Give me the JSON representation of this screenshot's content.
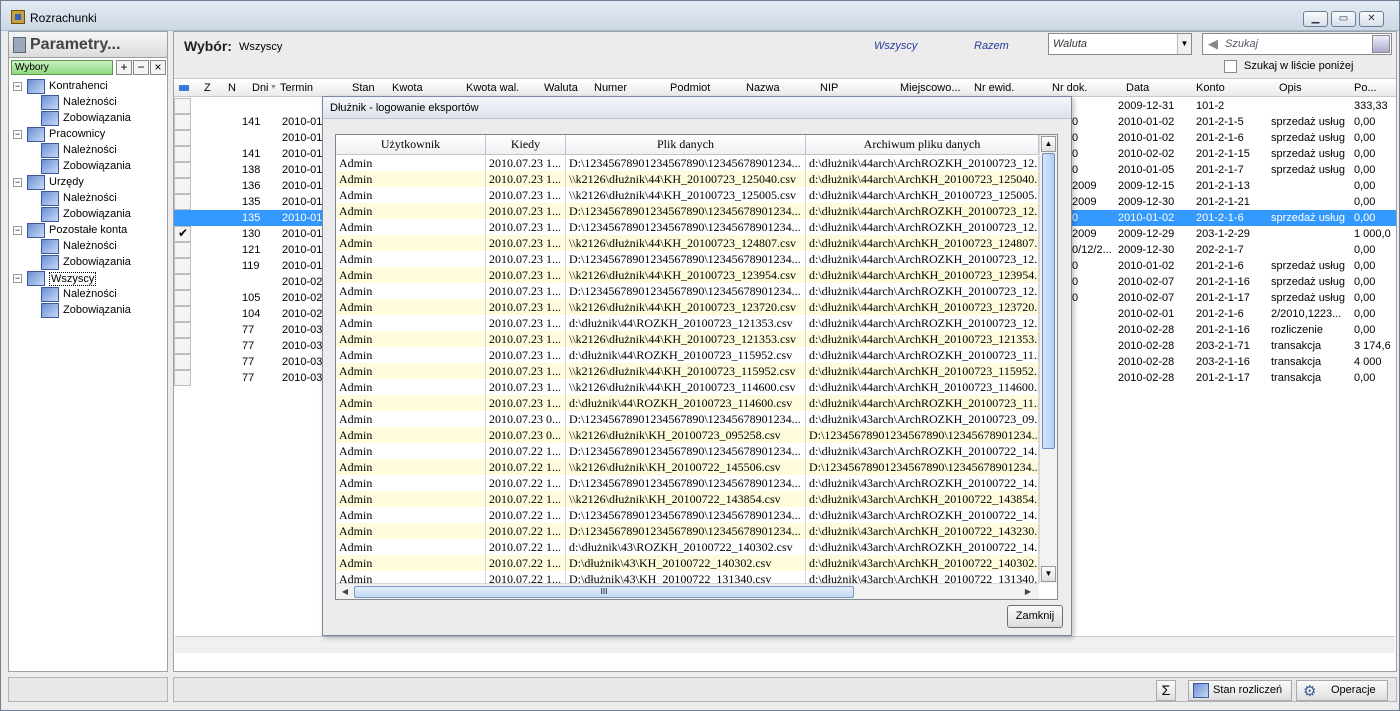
{
  "window": {
    "title": "Rozrachunki"
  },
  "left_panel": {
    "title": "Parametry...",
    "wybory_label": "Wybory",
    "tree": [
      {
        "label": "Kontrahenci",
        "children": [
          "Należności",
          "Zobowiązania"
        ]
      },
      {
        "label": "Pracownicy",
        "children": [
          "Należności",
          "Zobowiązania"
        ]
      },
      {
        "label": "Urzędy",
        "children": [
          "Należności",
          "Zobowiązania"
        ]
      },
      {
        "label": "Pozostałe konta",
        "children": [
          "Należności",
          "Zobowiązania"
        ]
      },
      {
        "label": "Wszyscy",
        "children": [
          "Należności",
          "Zobowiązania"
        ]
      }
    ]
  },
  "top": {
    "wybor_label": "Wybór:",
    "wybor_value": "Wszyscy",
    "filter_wszyscy": "Wszyscy",
    "filter_razem": "Razem",
    "currency_combo": "Waluta",
    "search_placeholder": "Szukaj",
    "search_in_list_label": "Szukaj w liście poniżej"
  },
  "grid": {
    "headers": [
      "Z",
      "N",
      "Dni",
      "Termin",
      "Stan",
      "Kwota",
      "Kwota wal.",
      "Waluta",
      "Numer",
      "Podmiot",
      "Nazwa",
      "NIP",
      "Miejscowo...",
      "Nr ewid.",
      "Nr dok.",
      "Data",
      "Konto",
      "Opis",
      "Po..."
    ],
    "rows": [
      {
        "dni": "",
        "termin": "",
        "nrdok": "",
        "data": "2009-12-31",
        "konto": "101-2",
        "opis": "",
        "po": "333,33",
        "checked": false,
        "selected": false
      },
      {
        "dni": "141",
        "termin": "2010-01",
        "nrdok": "0",
        "data": "2010-01-02",
        "konto": "201-2-1-5",
        "opis": "sprzedaż usług",
        "po": "0,00",
        "checked": false,
        "selected": false
      },
      {
        "dni": "",
        "termin": "2010-01",
        "nrdok": "0",
        "data": "2010-01-02",
        "konto": "201-2-1-6",
        "opis": "sprzedaż usług",
        "po": "0,00",
        "checked": false,
        "selected": false
      },
      {
        "dni": "141",
        "termin": "2010-01",
        "nrdok": "0",
        "data": "2010-02-02",
        "konto": "201-2-1-15",
        "opis": "sprzedaż usług",
        "po": "0,00",
        "checked": false,
        "selected": false
      },
      {
        "dni": "138",
        "termin": "2010-01",
        "nrdok": "0",
        "data": "2010-01-05",
        "konto": "201-2-1-7",
        "opis": "sprzedaż usług",
        "po": "0,00",
        "checked": false,
        "selected": false
      },
      {
        "dni": "136",
        "termin": "2010-01",
        "nrdok": "2009",
        "data": "2009-12-15",
        "konto": "201-2-1-13",
        "opis": "",
        "po": "0,00",
        "checked": false,
        "selected": false
      },
      {
        "dni": "135",
        "termin": "2010-01",
        "nrdok": "2009",
        "data": "2009-12-30",
        "konto": "201-2-1-21",
        "opis": "",
        "po": "0,00",
        "checked": false,
        "selected": false
      },
      {
        "dni": "135",
        "termin": "2010-01",
        "nrdok": "0",
        "data": "2010-01-02",
        "konto": "201-2-1-6",
        "opis": "sprzedaż usług",
        "po": "0,00",
        "checked": false,
        "selected": true
      },
      {
        "dni": "130",
        "termin": "2010-01",
        "nrdok": "2009",
        "data": "2009-12-29",
        "konto": "203-1-2-29",
        "opis": "",
        "po": "1 000,0",
        "checked": true,
        "selected": false
      },
      {
        "dni": "121",
        "termin": "2010-01",
        "nrdok": "0/12/2...",
        "data": "2009-12-30",
        "konto": "202-2-1-7",
        "opis": "",
        "po": "0,00",
        "checked": false,
        "selected": false
      },
      {
        "dni": "119",
        "termin": "2010-01",
        "nrdok": "0",
        "data": "2010-01-02",
        "konto": "201-2-1-6",
        "opis": "sprzedaż usług",
        "po": "0,00",
        "checked": false,
        "selected": false
      },
      {
        "dni": "",
        "termin": "2010-02",
        "nrdok": "0",
        "data": "2010-02-07",
        "konto": "201-2-1-16",
        "opis": "sprzedaż usług",
        "po": "0,00",
        "checked": false,
        "selected": false
      },
      {
        "dni": "105",
        "termin": "2010-02",
        "nrdok": "0",
        "data": "2010-02-07",
        "konto": "201-2-1-17",
        "opis": "sprzedaż usług",
        "po": "0,00",
        "checked": false,
        "selected": false
      },
      {
        "dni": "104",
        "termin": "2010-02",
        "nrdok": "",
        "data": "2010-02-01",
        "konto": "201-2-1-6",
        "opis": "2/2010,1223...",
        "po": "0,00",
        "checked": false,
        "selected": false
      },
      {
        "dni": "77",
        "termin": "2010-03",
        "nrdok": "",
        "data": "2010-02-28",
        "konto": "201-2-1-16",
        "opis": "rozliczenie",
        "po": "0,00",
        "checked": false,
        "selected": false
      },
      {
        "dni": "77",
        "termin": "2010-03",
        "nrdok": "",
        "data": "2010-02-28",
        "konto": "203-2-1-71",
        "opis": "transakcja",
        "po": "3 174,6",
        "checked": false,
        "selected": false
      },
      {
        "dni": "77",
        "termin": "2010-03",
        "nrdok": "",
        "data": "2010-02-28",
        "konto": "203-2-1-16",
        "opis": "transakcja",
        "po": "4 000",
        "checked": false,
        "selected": false
      },
      {
        "dni": "77",
        "termin": "2010-03",
        "nrdok": "",
        "data": "2010-02-28",
        "konto": "201-2-1-17",
        "opis": "transakcja",
        "po": "0,00",
        "checked": false,
        "selected": false
      }
    ]
  },
  "bottom": {
    "stan_rozliczen": "Stan rozliczeń",
    "operacje": "Operacje"
  },
  "dialog": {
    "title": "Dłużnik - logowanie eksportów",
    "headers": [
      "Użytkownik",
      "Kiedy",
      "Plik danych",
      "Archiwum pliku danych"
    ],
    "rows": [
      [
        "Admin",
        "2010.07.23 1...",
        "D:\\12345678901234567890\\12345678901234...",
        "d:\\dłużnik\\44arch\\ArchROZKH_20100723_12..."
      ],
      [
        "Admin",
        "2010.07.23 1...",
        "\\\\k2126\\dłużnik\\44\\KH_20100723_125040.csv",
        "d:\\dłużnik\\44arch\\ArchKH_20100723_125040..."
      ],
      [
        "Admin",
        "2010.07.23 1...",
        "\\\\k2126\\dłużnik\\44\\KH_20100723_125005.csv",
        "d:\\dłużnik\\44arch\\ArchKH_20100723_125005..."
      ],
      [
        "Admin",
        "2010.07.23 1...",
        "D:\\12345678901234567890\\12345678901234...",
        "d:\\dłużnik\\44arch\\ArchROZKH_20100723_12..."
      ],
      [
        "Admin",
        "2010.07.23 1...",
        "D:\\12345678901234567890\\12345678901234...",
        "d:\\dłużnik\\44arch\\ArchROZKH_20100723_12..."
      ],
      [
        "Admin",
        "2010.07.23 1...",
        "\\\\k2126\\dłużnik\\44\\KH_20100723_124807.csv",
        "d:\\dłużnik\\44arch\\ArchKH_20100723_124807..."
      ],
      [
        "Admin",
        "2010.07.23 1...",
        "D:\\12345678901234567890\\12345678901234...",
        "d:\\dłużnik\\44arch\\ArchROZKH_20100723_12..."
      ],
      [
        "Admin",
        "2010.07.23 1...",
        "\\\\k2126\\dłużnik\\44\\KH_20100723_123954.csv",
        "d:\\dłużnik\\44arch\\ArchKH_20100723_123954..."
      ],
      [
        "Admin",
        "2010.07.23 1...",
        "D:\\12345678901234567890\\12345678901234...",
        "d:\\dłużnik\\44arch\\ArchROZKH_20100723_12..."
      ],
      [
        "Admin",
        "2010.07.23 1...",
        "\\\\k2126\\dłużnik\\44\\KH_20100723_123720.csv",
        "d:\\dłużnik\\44arch\\ArchKH_20100723_123720..."
      ],
      [
        "Admin",
        "2010.07.23 1...",
        "d:\\dłużnik\\44\\ROZKH_20100723_121353.csv",
        "d:\\dłużnik\\44arch\\ArchROZKH_20100723_12..."
      ],
      [
        "Admin",
        "2010.07.23 1...",
        "\\\\k2126\\dłużnik\\44\\KH_20100723_121353.csv",
        "d:\\dłużnik\\44arch\\ArchKH_20100723_121353..."
      ],
      [
        "Admin",
        "2010.07.23 1...",
        "d:\\dłużnik\\44\\ROZKH_20100723_115952.csv",
        "d:\\dłużnik\\44arch\\ArchROZKH_20100723_11..."
      ],
      [
        "Admin",
        "2010.07.23 1...",
        "\\\\k2126\\dłużnik\\44\\KH_20100723_115952.csv",
        "d:\\dłużnik\\44arch\\ArchKH_20100723_115952..."
      ],
      [
        "Admin",
        "2010.07.23 1...",
        "\\\\k2126\\dłużnik\\44\\KH_20100723_114600.csv",
        "d:\\dłużnik\\44arch\\ArchKH_20100723_114600..."
      ],
      [
        "Admin",
        "2010.07.23 1...",
        "d:\\dłużnik\\44\\ROZKH_20100723_114600.csv",
        "d:\\dłużnik\\44arch\\ArchROZKH_20100723_11..."
      ],
      [
        "Admin",
        "2010.07.23 0...",
        "D:\\12345678901234567890\\12345678901234...",
        "d:\\dłużnik\\43arch\\ArchROZKH_20100723_09..."
      ],
      [
        "Admin",
        "2010.07.23 0...",
        "\\\\k2126\\dłużnik\\KH_20100723_095258.csv",
        "D:\\12345678901234567890\\12345678901234..."
      ],
      [
        "Admin",
        "2010.07.22 1...",
        "D:\\12345678901234567890\\12345678901234...",
        "d:\\dłużnik\\43arch\\ArchROZKH_20100722_14..."
      ],
      [
        "Admin",
        "2010.07.22 1...",
        "\\\\k2126\\dłużnik\\KH_20100722_145506.csv",
        "D:\\12345678901234567890\\12345678901234..."
      ],
      [
        "Admin",
        "2010.07.22 1...",
        "D:\\12345678901234567890\\12345678901234...",
        "d:\\dłużnik\\43arch\\ArchROZKH_20100722_14..."
      ],
      [
        "Admin",
        "2010.07.22 1...",
        "\\\\k2126\\dłużnik\\KH_20100722_143854.csv",
        "d:\\dłużnik\\43arch\\ArchKH_20100722_143854..."
      ],
      [
        "Admin",
        "2010.07.22 1...",
        "D:\\12345678901234567890\\12345678901234...",
        "d:\\dłużnik\\43arch\\ArchROZKH_20100722_14..."
      ],
      [
        "Admin",
        "2010.07.22 1...",
        "D:\\12345678901234567890\\12345678901234...",
        "d:\\dłużnik\\43arch\\ArchKH_20100722_143230..."
      ],
      [
        "Admin",
        "2010.07.22 1...",
        "d:\\dłużnik\\43\\ROZKH_20100722_140302.csv",
        "d:\\dłużnik\\43arch\\ArchROZKH_20100722_14..."
      ],
      [
        "Admin",
        "2010.07.22 1...",
        "D:\\dłużnik\\43\\KH_20100722_140302.csv",
        "d:\\dłużnik\\43arch\\ArchKH_20100722_140302..."
      ],
      [
        "Admin",
        "2010.07.22 1...",
        "D:\\dłużnik\\43\\KH_20100722_131340.csv",
        "d:\\dłużnik\\43arch\\ArchKH_20100722_131340..."
      ]
    ],
    "hscroll_grip": "III",
    "close_button": "Zamknij"
  }
}
